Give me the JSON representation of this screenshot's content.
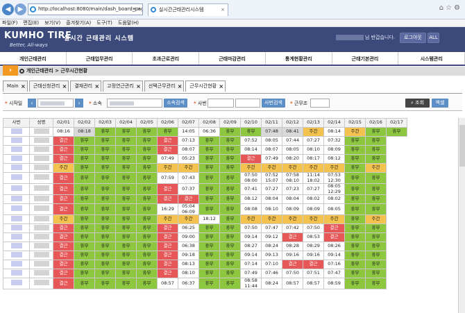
{
  "browser": {
    "url": "http://localhost:8080/main/dash_board_page",
    "tab_title": "실시간근태관리시스템"
  },
  "menu": [
    "파일(F)",
    "편집(E)",
    "보기(V)",
    "즐겨찾기(A)",
    "도구(T)",
    "도움말(H)"
  ],
  "header": {
    "logo": "KUMHO TIRE",
    "slogan": "Better, All-ways",
    "title": "실시간 근태관리 시스템",
    "greeting": "님 반갑습니다.",
    "logout": "로그아웃",
    "all": "ALL"
  },
  "nav": [
    "개인근태관리",
    "근태업무관리",
    "초과근로관리",
    "근태마감관리",
    "통계현황관리",
    "근태기본관리",
    "시스템관리"
  ],
  "breadcrumb": "개인근태관리 > 근무시간현황",
  "tabs": [
    "Main",
    "근태신청관리",
    "결재관리",
    "고정연근관리",
    "선택근무관리",
    "근무시간현황"
  ],
  "filter": {
    "start_label": "시작일",
    "dept_label": "소속",
    "dept_btn": "소속검색",
    "emp_label": "사번",
    "emp_btn": "사번검색",
    "shift_label": "근무조",
    "search": "조회",
    "excel": "엑셀"
  },
  "columns": [
    "사번",
    "성명",
    "02/01",
    "02/02",
    "02/03",
    "02/04",
    "02/05",
    "02/06",
    "02/07",
    "02/08",
    "02/09",
    "02/10",
    "02/11",
    "02/12",
    "02/13",
    "02/14",
    "02/15",
    "02/16",
    "02/17"
  ],
  "rows": [
    [
      "w:08:16",
      "gr:08:18",
      "g:휴무",
      "g:휴무",
      "g:휴무",
      "g:휴무",
      "w:14:05",
      "w:06:36",
      "g:휴무",
      "g:휴무",
      "gr:07:48",
      "gr:08:41",
      "y:주간",
      "w:08:14",
      "y:주간",
      "g:휴무",
      "g:휴무"
    ],
    [
      "red:결근",
      "g:휴무",
      "g:휴무",
      "g:휴무",
      "g:휴무",
      "red:결근",
      "w:07:13",
      "g:휴무",
      "g:휴무",
      "w:07:52",
      "w:08:05",
      "w:07:44",
      "w:07:27",
      "w:07:32",
      "g:휴무",
      "g:휴무"
    ],
    [
      "red:결근",
      "g:휴무",
      "g:휴무",
      "g:휴무",
      "g:휴무",
      "red:결근",
      "w:08:07",
      "g:휴무",
      "g:휴무",
      "w:08:14",
      "w:08:07",
      "w:08:05",
      "w:08:10",
      "w:08:09",
      "g:휴무",
      "g:휴무"
    ],
    [
      "red:결근",
      "g:휴무",
      "g:휴무",
      "g:휴무",
      "g:휴무",
      "w:07:49",
      "w:05:23",
      "g:휴무",
      "g:휴무",
      "red:결근",
      "w:07:49",
      "w:08:20",
      "w:08:17",
      "w:08:12",
      "g:휴무",
      "g:휴무"
    ],
    [
      "y:주간",
      "g:휴무",
      "g:휴무",
      "g:휴무",
      "g:휴무",
      "y:주간",
      "y:주간",
      "g:휴무",
      "g:휴무",
      "y:주간",
      "y:주간",
      "y:주간",
      "y:주간",
      "y:주간",
      "g:휴무",
      "y:주간"
    ],
    [
      "red:결근",
      "g:휴무",
      "g:휴무",
      "g:휴무",
      "g:휴무",
      "w:07:59",
      "w:07:43",
      "g:휴무",
      "g:휴무",
      "w:07:50 08:00",
      "w:07:52 15:07",
      "w:07:58 08:10",
      "w:11:14 18:02",
      "w:07:53 12:30",
      "g:휴무",
      "g:휴무"
    ],
    [
      "red:결근",
      "g:휴무",
      "g:휴무",
      "g:휴무",
      "g:휴무",
      "red:결근",
      "w:07:37",
      "g:휴무",
      "g:휴무",
      "w:07:41",
      "w:07:27",
      "w:07:23",
      "w:07:27",
      "w:08:05 12:29",
      "g:휴무",
      "g:휴무"
    ],
    [
      "red:결근",
      "g:휴무",
      "g:휴무",
      "g:휴무",
      "g:휴무",
      "red:결근",
      "red:결근",
      "g:휴무",
      "g:휴무",
      "w:08:12",
      "w:08:04",
      "w:08:04",
      "w:08:02",
      "w:08:02",
      "g:휴무",
      "g:휴무"
    ],
    [
      "red:결근",
      "g:휴무",
      "g:휴무",
      "g:휴무",
      "g:휴무",
      "w:16:29",
      "w:05:04 06:09",
      "g:휴무",
      "g:휴무",
      "w:08:08",
      "w:08:10",
      "w:08:09",
      "w:08:09",
      "w:08:05",
      "g:휴무",
      "g:휴무"
    ],
    [
      "y:주간",
      "g:휴무",
      "g:휴무",
      "g:휴무",
      "g:휴무",
      "y:주간",
      "y:주간",
      "w:18:12",
      "g:휴무",
      "y:주간",
      "y:주간",
      "y:주간",
      "y:주간",
      "y:주간",
      "g:휴무",
      "y:주간"
    ],
    [
      "red:결근",
      "g:휴무",
      "g:휴무",
      "g:휴무",
      "g:휴무",
      "red:결근",
      "w:06:25",
      "g:휴무",
      "g:휴무",
      "w:07:50",
      "w:07:47",
      "w:07:42",
      "w:07:50",
      "red:결근",
      "g:휴무",
      "g:휴무"
    ],
    [
      "red:결근",
      "g:휴무",
      "g:휴무",
      "g:휴무",
      "g:휴무",
      "red:결근",
      "w:09:00",
      "g:휴무",
      "g:휴무",
      "w:09:14",
      "w:09:12",
      "red:결근",
      "w:08:53",
      "red:결근",
      "g:휴무",
      "g:휴무"
    ],
    [
      "red:결근",
      "g:휴무",
      "g:휴무",
      "g:휴무",
      "g:휴무",
      "red:결근",
      "w:06:38",
      "g:휴무",
      "g:휴무",
      "w:08:27",
      "w:08:24",
      "w:08:28",
      "w:08:29",
      "w:08:26",
      "g:휴무",
      "g:휴무"
    ],
    [
      "red:결근",
      "g:휴무",
      "g:휴무",
      "g:휴무",
      "g:휴무",
      "red:결근",
      "w:09:18",
      "g:휴무",
      "g:휴무",
      "w:09:14",
      "w:09:13",
      "w:09:16",
      "w:09:16",
      "w:09:14",
      "g:휴무",
      "g:휴무"
    ],
    [
      "red:결근",
      "g:휴무",
      "g:휴무",
      "g:휴무",
      "g:휴무",
      "red:결근",
      "w:08:13",
      "g:휴무",
      "g:휴무",
      "w:07:14",
      "w:07:10",
      "red:결근",
      "red:결근",
      "w:07:16",
      "g:휴무",
      "g:휴무"
    ],
    [
      "red:결근",
      "g:휴무",
      "g:휴무",
      "g:휴무",
      "g:휴무",
      "red:결근",
      "w:08:10",
      "g:휴무",
      "g:휴무",
      "w:07:49",
      "w:07:46",
      "w:07:50",
      "w:07:51",
      "w:07:47",
      "g:휴무",
      "g:휴무"
    ],
    [
      "red:결근",
      "g:휴무",
      "g:휴무",
      "g:휴무",
      "g:휴무",
      "w:08:57",
      "w:06:37",
      "g:휴무",
      "g:휴무",
      "w:08:58 11:44",
      "w:08:24",
      "w:08:57",
      "w:08:57",
      "w:08:59",
      "g:휴무",
      "g:휴무"
    ]
  ]
}
